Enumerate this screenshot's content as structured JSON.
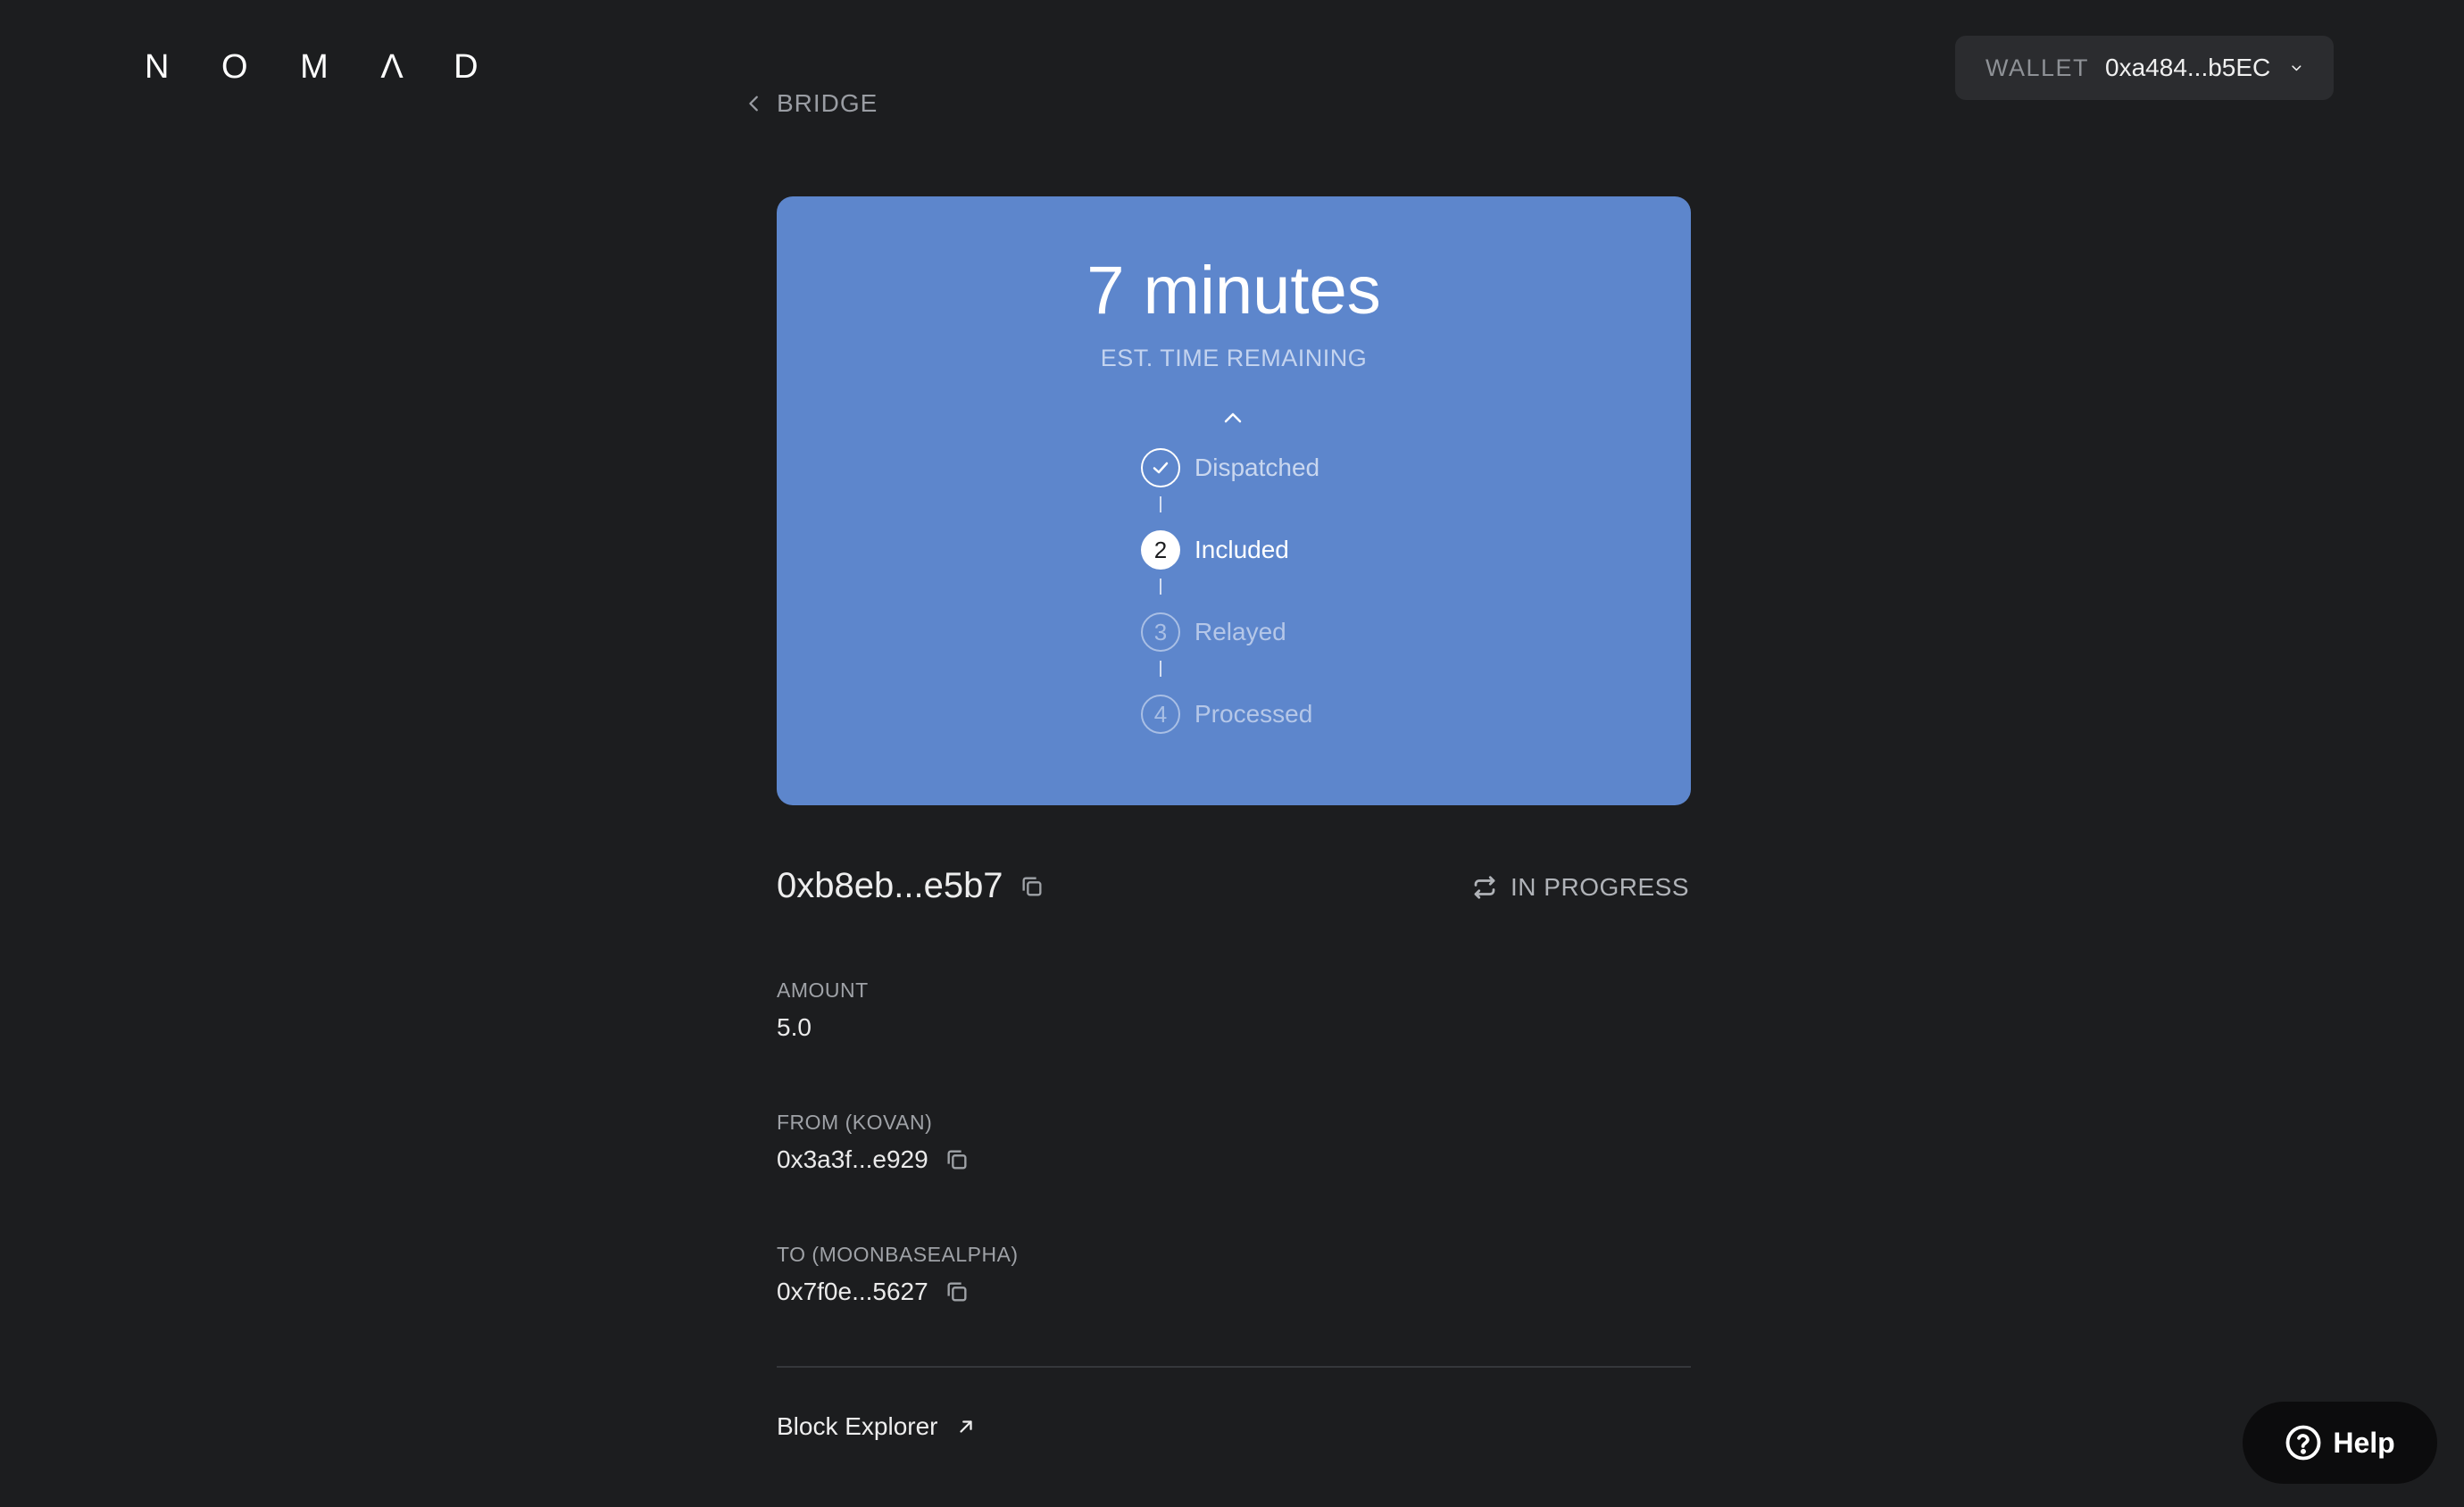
{
  "header": {
    "logo": "N O M Λ D",
    "back_label": "BRIDGE",
    "wallet": {
      "label": "WALLET",
      "address": "0xa484...b5EC"
    }
  },
  "status_card": {
    "time_remaining": "7 minutes",
    "subtitle": "EST. TIME REMAINING",
    "steps": [
      {
        "number": "1",
        "label": "Dispatched",
        "state": "done"
      },
      {
        "number": "2",
        "label": "Included",
        "state": "active"
      },
      {
        "number": "3",
        "label": "Relayed",
        "state": "todo"
      },
      {
        "number": "4",
        "label": "Processed",
        "state": "todo"
      }
    ]
  },
  "transfer": {
    "hash": "0xb8eb...e5b7",
    "status": "IN PROGRESS",
    "amount_label": "AMOUNT",
    "amount_value": "5.0",
    "from_label": "FROM (KOVAN)",
    "from_value": "0x3a3f...e929",
    "to_label": "TO (MOONBASEALPHA)",
    "to_value": "0x7f0e...5627",
    "explorer_label": "Block Explorer"
  },
  "help": {
    "label": "Help"
  },
  "colors": {
    "background": "#1c1d1f",
    "card": "#5d86cc",
    "wallet_bg": "#2b2c2f"
  }
}
